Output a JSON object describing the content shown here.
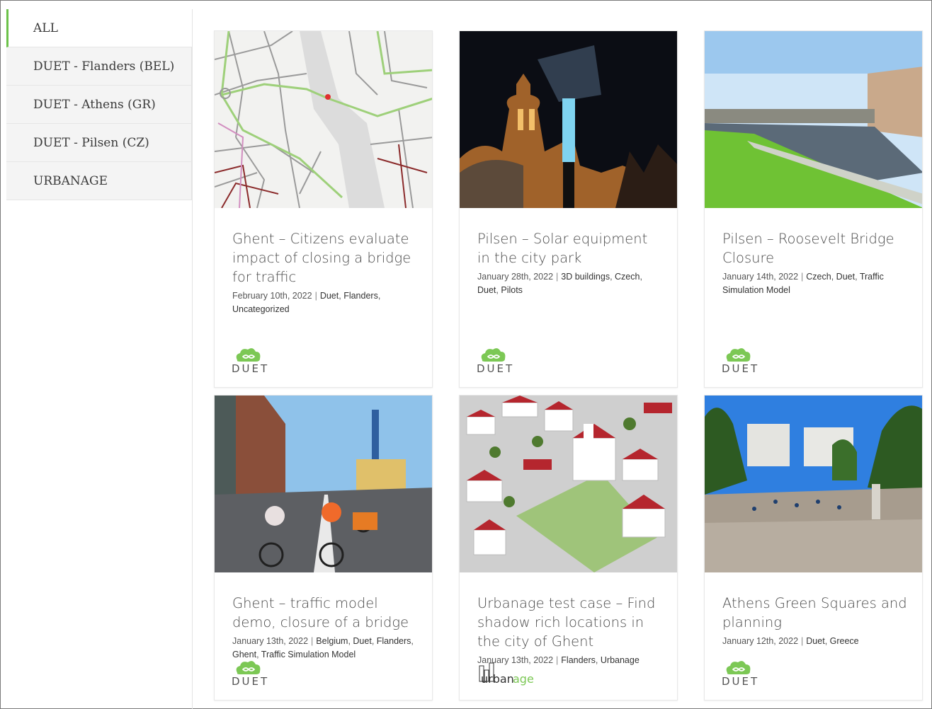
{
  "filters": [
    {
      "label": "ALL",
      "active": true
    },
    {
      "label": "DUET - Flanders (BEL)",
      "active": false
    },
    {
      "label": "DUET - Athens (GR)",
      "active": false
    },
    {
      "label": "DUET - Pilsen (CZ)",
      "active": false
    },
    {
      "label": "URBANAGE",
      "active": false
    }
  ],
  "posts": [
    {
      "title": "Ghent – Citizens evaluate impact of closing a bridge for traffic",
      "date": "February 10th, 2022",
      "categories": [
        "Duet",
        "Flanders",
        "Uncategorized"
      ],
      "logo": "DUET"
    },
    {
      "title": "Pilsen – Solar equipment in the city park",
      "date": "January 28th, 2022",
      "categories": [
        "3D buildings",
        "Czech",
        "Duet",
        "Pilots"
      ],
      "logo": "DUET"
    },
    {
      "title": "Pilsen – Roosevelt Bridge Closure",
      "date": "January 14th, 2022",
      "categories": [
        "Czech",
        "Duet",
        "Traffic Simulation Model"
      ],
      "logo": "DUET"
    },
    {
      "title": "Ghent – traffic model demo, closure of a bridge",
      "date": "January 13th, 2022",
      "categories": [
        "Belgium",
        "Duet",
        "Flanders",
        "Ghent",
        "Traffic Simulation Model"
      ],
      "logo": "DUET"
    },
    {
      "title": "Urbanage test case – Find shadow rich locations in the city of Ghent",
      "date": "January 13th, 2022",
      "categories": [
        "Flanders",
        "Urbanage"
      ],
      "logo": "Urbanage"
    },
    {
      "title": "Athens Green Squares and planning",
      "date": "January 12th, 2022",
      "categories": [
        "Duet",
        "Greece"
      ],
      "logo": "DUET"
    }
  ],
  "logo_texts": {
    "duet": "DUET",
    "urban": "urban",
    "age": "age"
  },
  "colors": {
    "accent": "#6cc24a",
    "logo_green": "#7cc855"
  }
}
